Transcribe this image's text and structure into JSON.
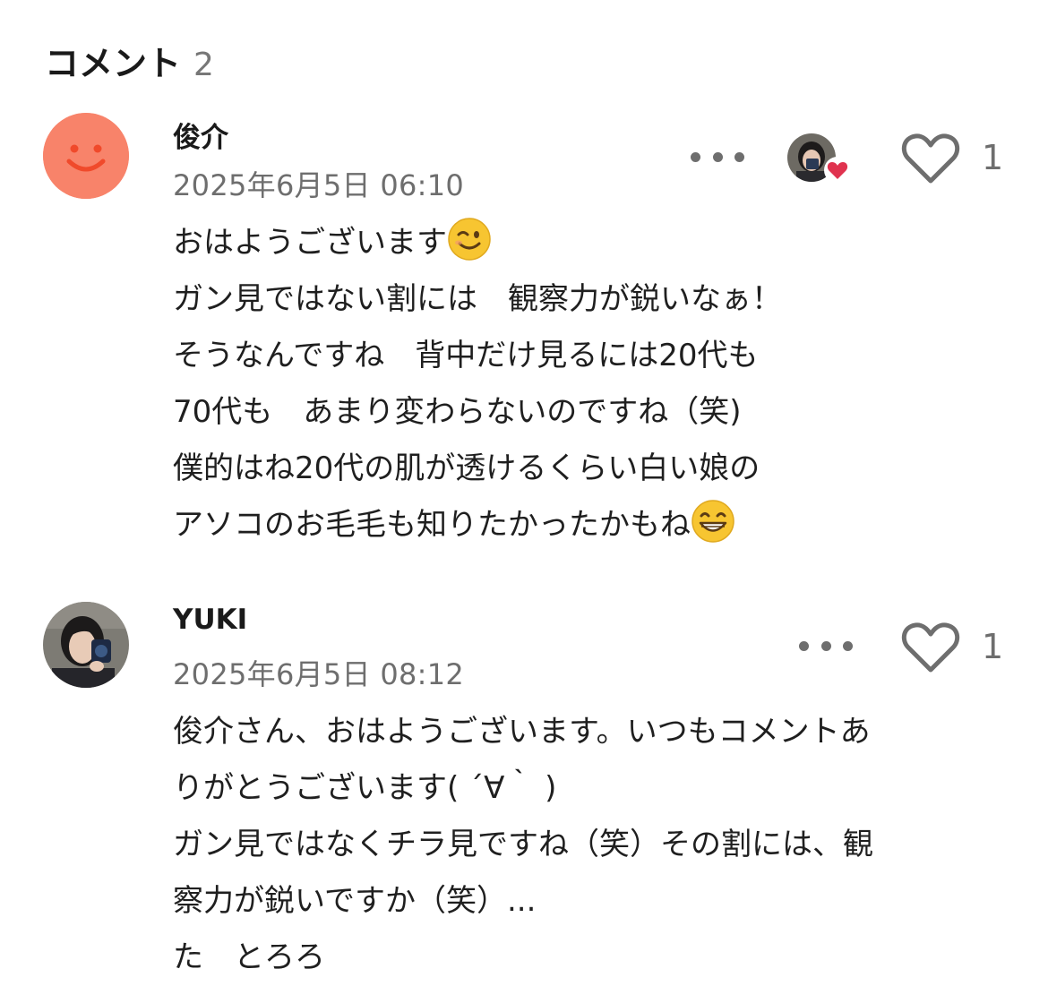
{
  "header": {
    "title": "コメント",
    "count": "2"
  },
  "comments": [
    {
      "author": "俊介",
      "timestamp": "2025年6月5日 06:10",
      "avatar_icon": "smiley-face-icon",
      "avatar_color": "#f8836a",
      "lines": [
        "おはようございます",
        "ガン見ではない割には　観察力が鋭いなぁ！",
        "そうなんですね　背中だけ見るには20代も",
        "70代も　あまり変わらないのですね（笑)",
        "僕的はね20代の肌が透けるくらい白い娘の",
        "アソコのお毛毛も知りたかったかもね"
      ],
      "line_emojis": [
        "winking-face-icon",
        "",
        "",
        "",
        "",
        "grinning-face-icon"
      ],
      "liked_by_author": true,
      "like_count": "1"
    },
    {
      "author": "YUKI",
      "timestamp": "2025年6月5日 08:12",
      "avatar_icon": "user-photo-avatar",
      "lines": [
        "俊介さん、おはようございます。いつもコメントあ",
        "りがとうございます( ´∀｀ )",
        "ガン見ではなくチラ見ですね（笑）その割には、観",
        "察力が鋭いですか（笑）...",
        "た　とろろ"
      ],
      "liked_by_author": false,
      "like_count": "1"
    }
  ],
  "colors": {
    "accent_heart": "#e0334f",
    "muted_text": "#6e6e6e",
    "avatar_orange": "#f8836a"
  }
}
